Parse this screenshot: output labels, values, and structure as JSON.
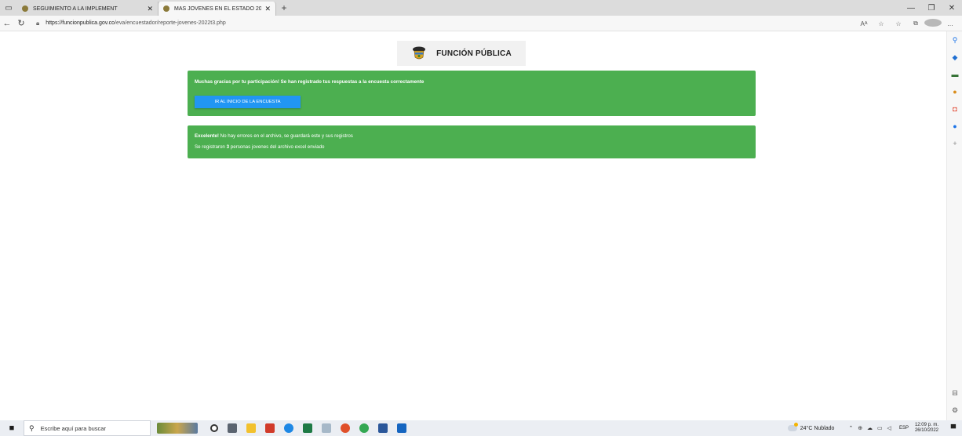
{
  "browser": {
    "tabs": [
      {
        "title": "SEGUIMIENTO A LA IMPLEMENT",
        "active": false
      },
      {
        "title": "MÁS JÓVENES EN EL ESTADO 20",
        "active": true
      }
    ],
    "new_tab_symbol": "+",
    "window_controls": [
      "—",
      "❐",
      "✕"
    ],
    "url_host": "https://funcionpublica.gov.co",
    "url_path": "/eva/encuestador/reporte-jovenes-2022t3.php",
    "toolbar_icons": [
      "Aᴬ",
      "☆",
      "☆",
      "⧉",
      "…"
    ]
  },
  "page": {
    "logo_text": "FUNCIÓN PÚBLICA",
    "success_alert": {
      "message": "Muchas gracias por tu participación! Se han registrado tus respuestas a la encuesta correctamente",
      "button_label": "IR AL INICIO DE LA ENCUESTA"
    },
    "info_alert": {
      "line1_strong": "Excelente!",
      "line1_rest": " No hay errores en el archivo, se guardará este y sus registros",
      "line2_pre": "Se registraron ",
      "line2_count": "3",
      "line2_post": " personas jovenes del archivo excel enviado"
    },
    "colors": {
      "alert_green": "#4caf50",
      "button_blue": "#2196f3"
    }
  },
  "taskbar": {
    "search_placeholder": "Escribe aquí para buscar",
    "weather": "24°C  Nublado",
    "language": "ESP",
    "time": "12:09 p. m.",
    "date": "26/10/2022"
  }
}
